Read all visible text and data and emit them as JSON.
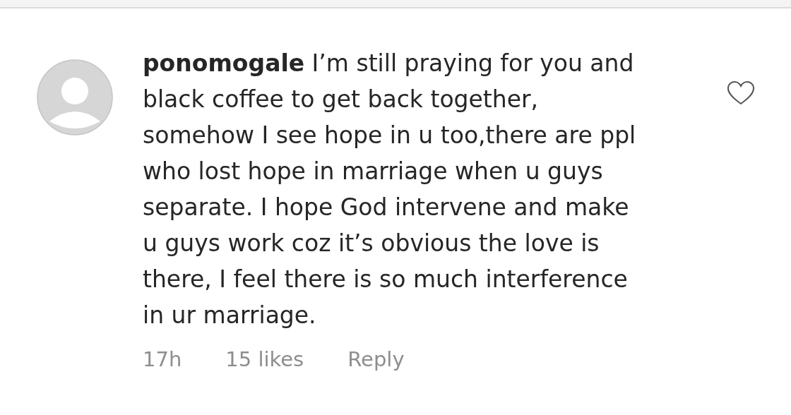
{
  "comment": {
    "text": "**ponomogale** I’m still praying for you and black coffee to get back together, somehow I see hope in u too,there are ppl who lost hope in marriage when u guys separate. I hope God intervene and make u guys work coz it’s obvious the love is there, I feel there is so much interference in ur marriage.",
    "liked": false,
    "time": "17h",
    "likes": "15 likes",
    "reply": "Reply"
  }
}
